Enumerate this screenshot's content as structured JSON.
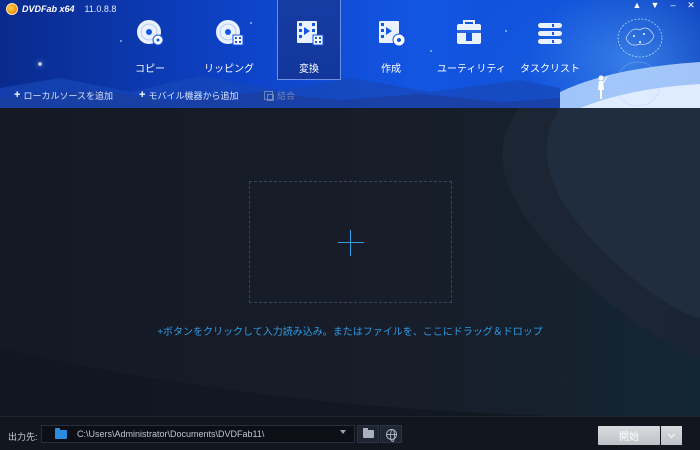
{
  "app": {
    "name": "DVDFab x64",
    "version": "11.0.8.8"
  },
  "window_controls": [
    "▲",
    "▼",
    "–",
    "✕"
  ],
  "nav": {
    "tabs": [
      {
        "label": "コピー",
        "icon": "disc-copy-icon",
        "active": false
      },
      {
        "label": "リッピング",
        "icon": "disc-rip-icon",
        "active": false
      },
      {
        "label": "変換",
        "icon": "video-convert-icon",
        "active": true
      },
      {
        "label": "作成",
        "icon": "video-create-icon",
        "active": false
      },
      {
        "label": "ユーティリティ",
        "icon": "utility-toolbox-icon",
        "active": false
      },
      {
        "label": "タスクリスト",
        "icon": "task-list-icon",
        "active": false
      }
    ]
  },
  "toolbar": {
    "add_local": "ローカルソースを追加",
    "add_mobile": "モバイル機器から追加",
    "merge": "結合"
  },
  "main": {
    "hint": "+ボタンをクリックして入力読み込み。またはファイルを、ここにドラッグ＆ドロップ"
  },
  "bottom": {
    "output_label": "出力先:",
    "output_path": "C:\\Users\\Administrator\\Documents\\DVDFab11\\",
    "start_label": "開始"
  },
  "colors": {
    "header_blue": "#1356e2",
    "accent_blue": "#2f9ce8",
    "main_bg": "#151a24",
    "start_button": "#c9ccd1"
  }
}
